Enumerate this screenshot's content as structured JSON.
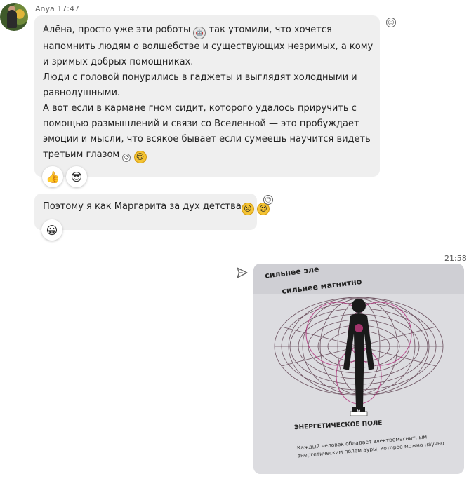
{
  "message1": {
    "sender": "Anya",
    "time": "17:47",
    "line1": "Алёна, просто уже эти роботы",
    "line1b": " так утомили, что хочется напомнить людям о волшебстве и существующих незримых, а кому и зримых добрых помощниках.",
    "line2": "Люди с головой понурились в гаджеты и выглядят холодными и равнодушными.",
    "line3": "А вот если в кармане гном сидит, которого удалось приручить с помощью размышлений и связи со Вселенной — это пробуждает эмоции и мысли, что всякое бывает если сумеешь научится видеть третьим глазом",
    "reactions": [
      "thumbs-up",
      "cool-smile"
    ]
  },
  "message2": {
    "text": "Поэтому я как Маргарита за дух детства",
    "reactions": [
      "grin"
    ]
  },
  "outgoing": {
    "time": "21:58",
    "photo": {
      "caption_top1": "сильнее эле",
      "caption_top2": "сильнее магнитно",
      "caption_title": "ЭНЕРГЕТИЧЕСКОЕ ПОЛЕ",
      "caption_body": "Каждый человек обладает электромагнитным энергетическим полем ауры, которое можно научно"
    }
  },
  "icons": {
    "react_icon": "smiley-outline-icon",
    "send_icon": "send-icon"
  }
}
